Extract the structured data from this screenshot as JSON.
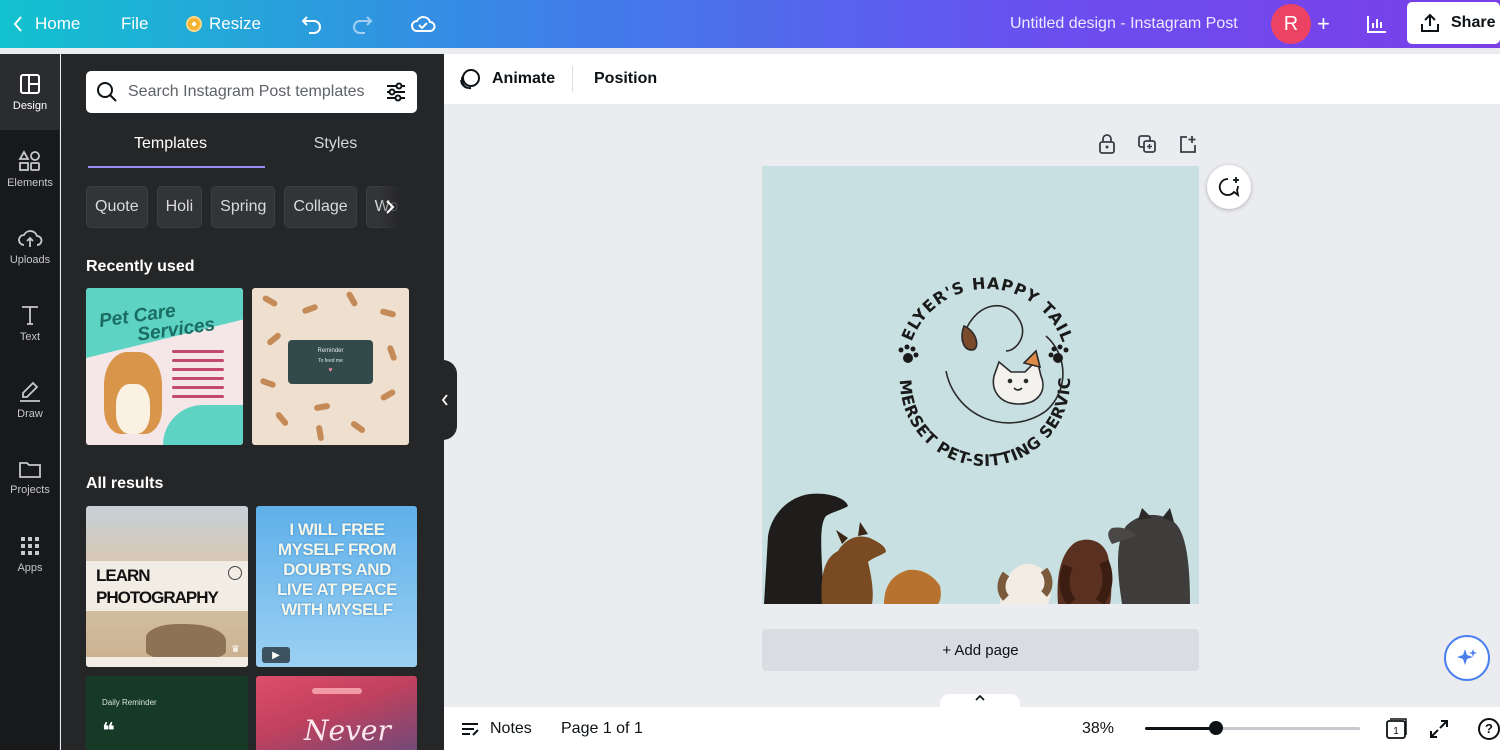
{
  "topbar": {
    "home": "Home",
    "file": "File",
    "resize": "Resize",
    "title": "Untitled design - Instagram Post",
    "avatar_initial": "R",
    "plus": "+",
    "share": "Share"
  },
  "rail": {
    "items": [
      {
        "label": "Design",
        "icon": "design-icon",
        "active": true
      },
      {
        "label": "Elements",
        "icon": "elements-icon"
      },
      {
        "label": "Uploads",
        "icon": "upload-cloud-icon"
      },
      {
        "label": "Text",
        "icon": "text-icon"
      },
      {
        "label": "Draw",
        "icon": "draw-icon"
      },
      {
        "label": "Projects",
        "icon": "folder-icon"
      },
      {
        "label": "Apps",
        "icon": "apps-grid-icon"
      }
    ]
  },
  "panel": {
    "search_placeholder": "Search Instagram Post templates",
    "tabs": [
      "Templates",
      "Styles"
    ],
    "chips": [
      "Quote",
      "Holi",
      "Spring",
      "Collage",
      "Wom"
    ],
    "recently_used": "Recently used",
    "all_results": "All results",
    "thumbs": {
      "pet_title_1": "Pet Care",
      "pet_title_2": "Services",
      "bones_card_1": "Reminder",
      "bones_card_2": "To feed me",
      "learn": "LEARN",
      "photography": "PHOTOGRAPHY",
      "free_text": "I WILL FREE MYSELF FROM DOUBTS AND LIVE AT PEACE WITH MYSELF",
      "daily": "Daily Reminder",
      "quote_mark": "❝",
      "never": "Never"
    }
  },
  "editor": {
    "animate": "Animate",
    "position": "Position",
    "logo_top": "HELYER'S HAPPY TAILS",
    "logo_bottom": "SOMERSET PET-SITTING SERVICES",
    "add_page": "+ Add page"
  },
  "footer": {
    "notes": "Notes",
    "page": "Page 1 of 1",
    "zoom": "38%",
    "zoom_level": 0.33,
    "page_count": "1",
    "help": "?"
  },
  "colors": {
    "gradient_start": "#12c2cf",
    "gradient_end": "#7b3fe8",
    "avatar": "#ec4264",
    "canvas_bg": "#c8e0e1",
    "panel_bg": "#252627"
  }
}
